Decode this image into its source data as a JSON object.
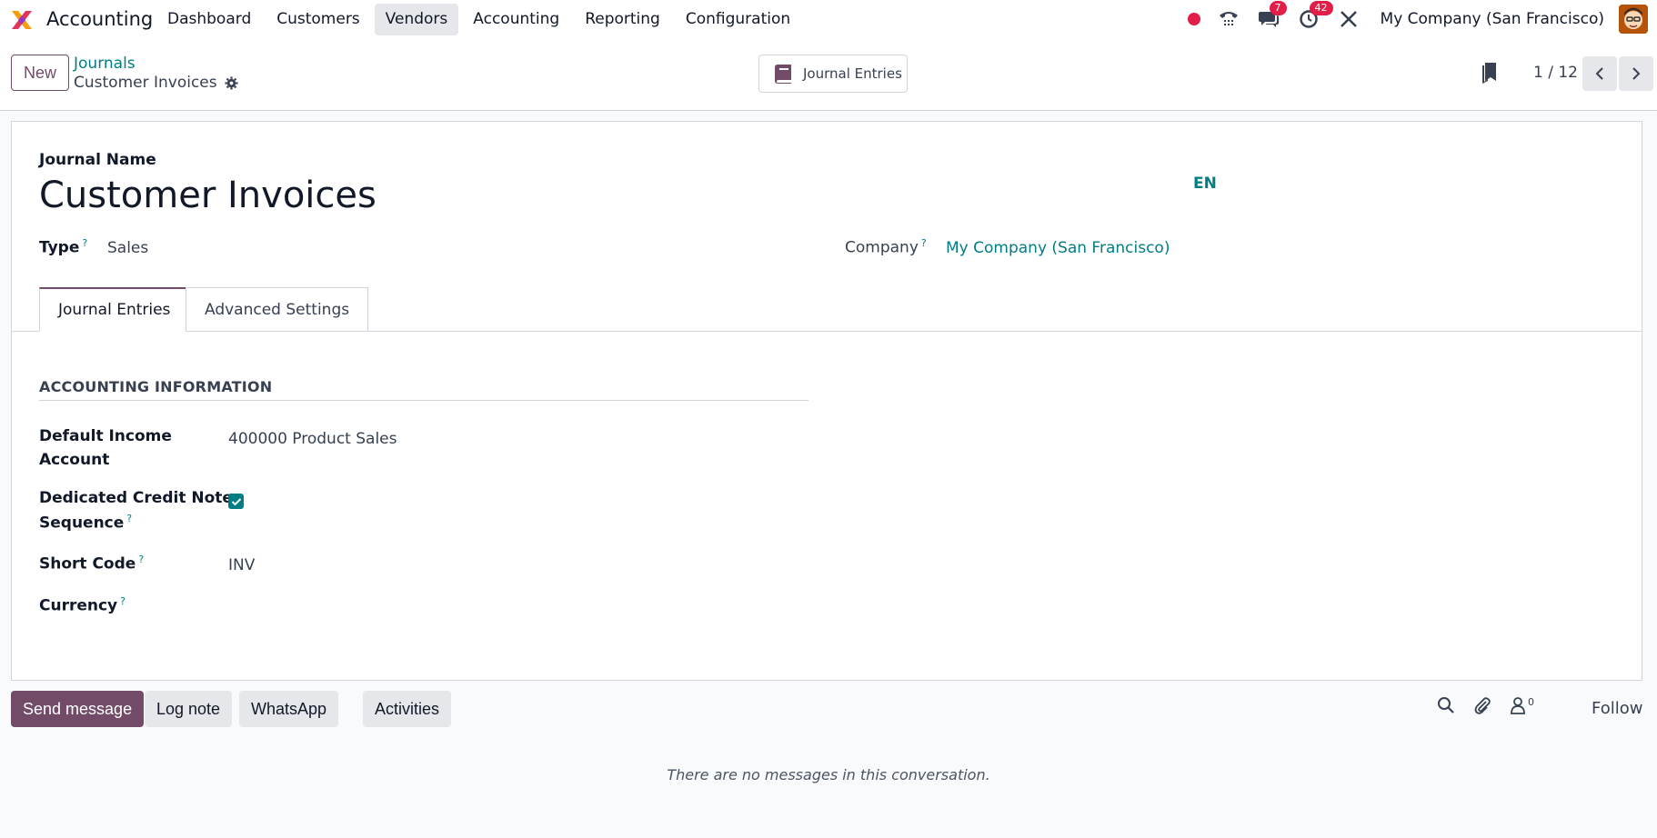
{
  "navbar": {
    "app_name": "Accounting",
    "menu": [
      "Dashboard",
      "Customers",
      "Vendors",
      "Accounting",
      "Reporting",
      "Configuration"
    ],
    "active_menu": "Vendors",
    "messages_badge": "7",
    "activities_badge": "42",
    "company": "My Company (San Francisco)"
  },
  "control": {
    "new_label": "New",
    "breadcrumb_parent": "Journals",
    "breadcrumb_current": "Customer Invoices",
    "smart_button_label": "Journal Entries",
    "pager": "1 / 12"
  },
  "form": {
    "name_label": "Journal Name",
    "name_value": "Customer Invoices",
    "lang": "EN",
    "type_label": "Type",
    "type_value": "Sales",
    "company_label": "Company",
    "company_value": "My Company (San Francisco)",
    "tabs": [
      "Journal Entries",
      "Advanced Settings"
    ],
    "section_title": "ACCOUNTING INFORMATION",
    "income_label_1": "Default Income",
    "income_label_2": "Account",
    "income_value": "400000 Product Sales",
    "credit_label_1": "Dedicated Credit Note",
    "credit_label_2": "Sequence",
    "credit_checked": true,
    "short_code_label": "Short Code",
    "short_code_value": "INV",
    "currency_label": "Currency",
    "help_mark": "?"
  },
  "chatter": {
    "send_message": "Send message",
    "log_note": "Log note",
    "whatsapp": "WhatsApp",
    "activities": "Activities",
    "followers_count": "0",
    "follow": "Follow",
    "empty_text": "There are no messages in this conversation."
  },
  "colors": {
    "brand": "#714b67",
    "accent": "#017e84",
    "badge": "#e11d48"
  }
}
